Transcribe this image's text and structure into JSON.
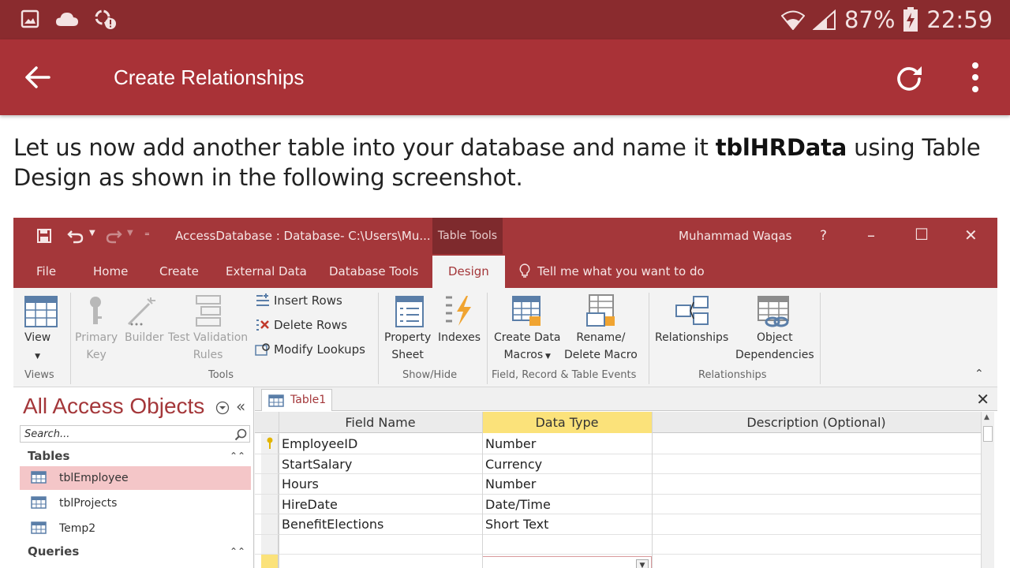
{
  "status_bar": {
    "battery": "87%",
    "time": "22:59",
    "icons": [
      "image-icon",
      "cloud-icon",
      "sync-alert-icon",
      "wifi-icon",
      "signal-icon",
      "battery-icon"
    ]
  },
  "app_bar": {
    "title": "Create Relationships",
    "icons": [
      "back-arrow-icon",
      "refresh-icon",
      "more-vert-icon"
    ]
  },
  "article": {
    "text_before": "Let us now add another table into your database and name it ",
    "bold": "tblHRData",
    "text_after": " using Table Design as shown in the following screenshot."
  },
  "access": {
    "title": "AccessDatabase : Database- C:\\Users\\Mu...",
    "context_tab": "Table Tools",
    "user": "Muhammad Waqas",
    "help": "?",
    "window_controls": [
      "–",
      "☐",
      "✕"
    ],
    "tabs": [
      "File",
      "Home",
      "Create",
      "External Data",
      "Database Tools",
      "Design"
    ],
    "tell_me": "Tell me what you want to do",
    "ribbon": {
      "view": "View",
      "primary_key": "Primary\nKey",
      "builder": "Builder",
      "test_validation": "Test Validation\nRules",
      "insert_rows": "Insert Rows",
      "delete_rows": "Delete Rows",
      "modify_lookups": "Modify Lookups",
      "property_sheet": "Property\nSheet",
      "indexes": "Indexes",
      "create_data_macros": "Create Data\nMacros",
      "rename_delete_macro": "Rename/\nDelete Macro",
      "relationships": "Relationships",
      "object_dependencies": "Object\nDependencies",
      "groups": [
        "Views",
        "Tools",
        "Show/Hide",
        "Field, Record & Table Events",
        "Relationships"
      ]
    },
    "nav": {
      "title": "All Access Objects",
      "search_placeholder": "Search...",
      "tables_header": "Tables",
      "tables": [
        "tblEmployee",
        "tblProjects",
        "Temp2"
      ],
      "queries_header": "Queries"
    },
    "document_tab": "Table1",
    "grid": {
      "headers": [
        "Field Name",
        "Data Type",
        "Description (Optional)"
      ],
      "rows": [
        {
          "field": "EmployeeID",
          "type": "Number"
        },
        {
          "field": "StartSalary",
          "type": "Currency"
        },
        {
          "field": "Hours",
          "type": "Number"
        },
        {
          "field": "HireDate",
          "type": "Date/Time"
        },
        {
          "field": "BenefitElections",
          "type": "Short Text"
        }
      ]
    }
  },
  "colors": {
    "status_bar": "#8a2b2e",
    "app_bar": "#a93237",
    "access_accent": "#a4373a",
    "data_type_header": "#fbe27a",
    "selected_nav_item": "#f4c6c8"
  }
}
